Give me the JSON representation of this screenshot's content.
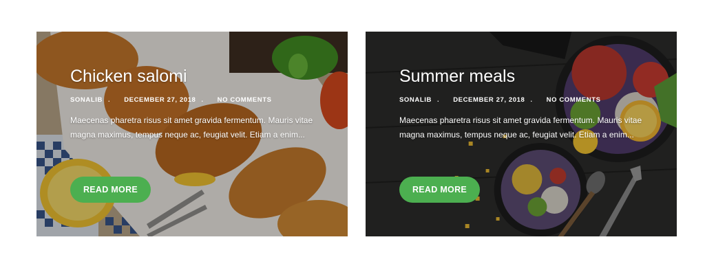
{
  "colors": {
    "accent": "#4caf50",
    "text": "#ffffff"
  },
  "posts": [
    {
      "title": "Chicken salomi",
      "author": "SONALIB",
      "date": "DECEMBER 27, 2018",
      "comments": "NO COMMENTS",
      "excerpt": "Maecenas pharetra risus sit amet gravida fermentum. Mauris vitae magna maximus, tempus neque ac, feugiat velit. Etiam a enim...",
      "button": "READ MORE",
      "image": "chicken-wings-photo"
    },
    {
      "title": "Summer meals",
      "author": "SONALIB",
      "date": "DECEMBER 27, 2018",
      "comments": "NO COMMENTS",
      "excerpt": "Maecenas pharetra risus sit amet gravida fermentum. Mauris vitae magna maximus, tempus neque ac, feugiat velit. Etiam a enim...",
      "button": "READ MORE",
      "image": "salad-bowls-photo"
    }
  ],
  "separator": "."
}
